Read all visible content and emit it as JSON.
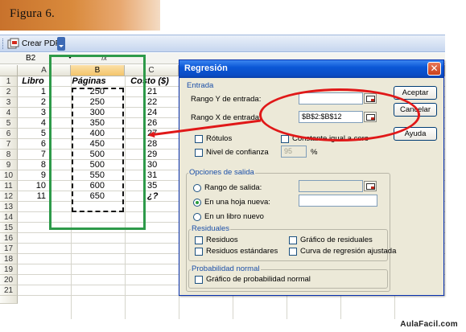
{
  "banner": {
    "title": "Figura 6."
  },
  "toolbar": {
    "crear_pdf_label": "Crear PDF"
  },
  "formula_bar": {
    "namebox_value": "B2",
    "fx_label": "fx"
  },
  "columns": [
    "A",
    "B",
    "C"
  ],
  "rows": [
    "1",
    "2",
    "3",
    "4",
    "5",
    "6",
    "7",
    "8",
    "9",
    "10",
    "11",
    "12",
    "13",
    "14",
    "15",
    "16",
    "17",
    "18",
    "19",
    "20",
    "21"
  ],
  "headers": {
    "a": "Libro",
    "b": "Páginas",
    "c": "Costo ($)"
  },
  "data": {
    "a": [
      "1",
      "2",
      "3",
      "4",
      "5",
      "6",
      "7",
      "8",
      "9",
      "10",
      "11"
    ],
    "b": [
      "250",
      "250",
      "300",
      "350",
      "400",
      "450",
      "500",
      "500",
      "550",
      "600",
      "650"
    ],
    "c": [
      "21",
      "22",
      "24",
      "26",
      "27",
      "28",
      "29",
      "30",
      "31",
      "35",
      "¿?"
    ]
  },
  "dialog": {
    "title": "Regresión",
    "entrada": "Entrada",
    "rango_y_label": "Rango Y de entrada:",
    "rango_y_value": "",
    "rango_x_label": "Rango X de entrada:",
    "rango_x_value": "$B$2:$B$12",
    "rotulos": "Rótulos",
    "constante_cero": "Constante igual a cero",
    "nivel_confianza": "Nivel de confianza",
    "nivel_confianza_value": "95",
    "percent": "%",
    "opciones_salida": "Opciones de salida",
    "rango_salida": "Rango de salida:",
    "hoja_nueva": "En una hoja nueva:",
    "libro_nuevo": "En un libro nuevo",
    "residuales": "Residuales",
    "residuos": "Residuos",
    "residuos_estandares": "Residuos estándares",
    "grafico_residuales": "Gráfico de residuales",
    "curva_regresion": "Curva de regresión ajustada",
    "probabilidad_normal": "Probabilidad normal",
    "grafico_probabilidad": "Gráfico de probabilidad normal",
    "aceptar": "Aceptar",
    "cancelar": "Cancelar",
    "ayuda": "Ayuda",
    "close_glyph": "✕"
  },
  "footer": {
    "brand": "AulaFacil.com"
  }
}
